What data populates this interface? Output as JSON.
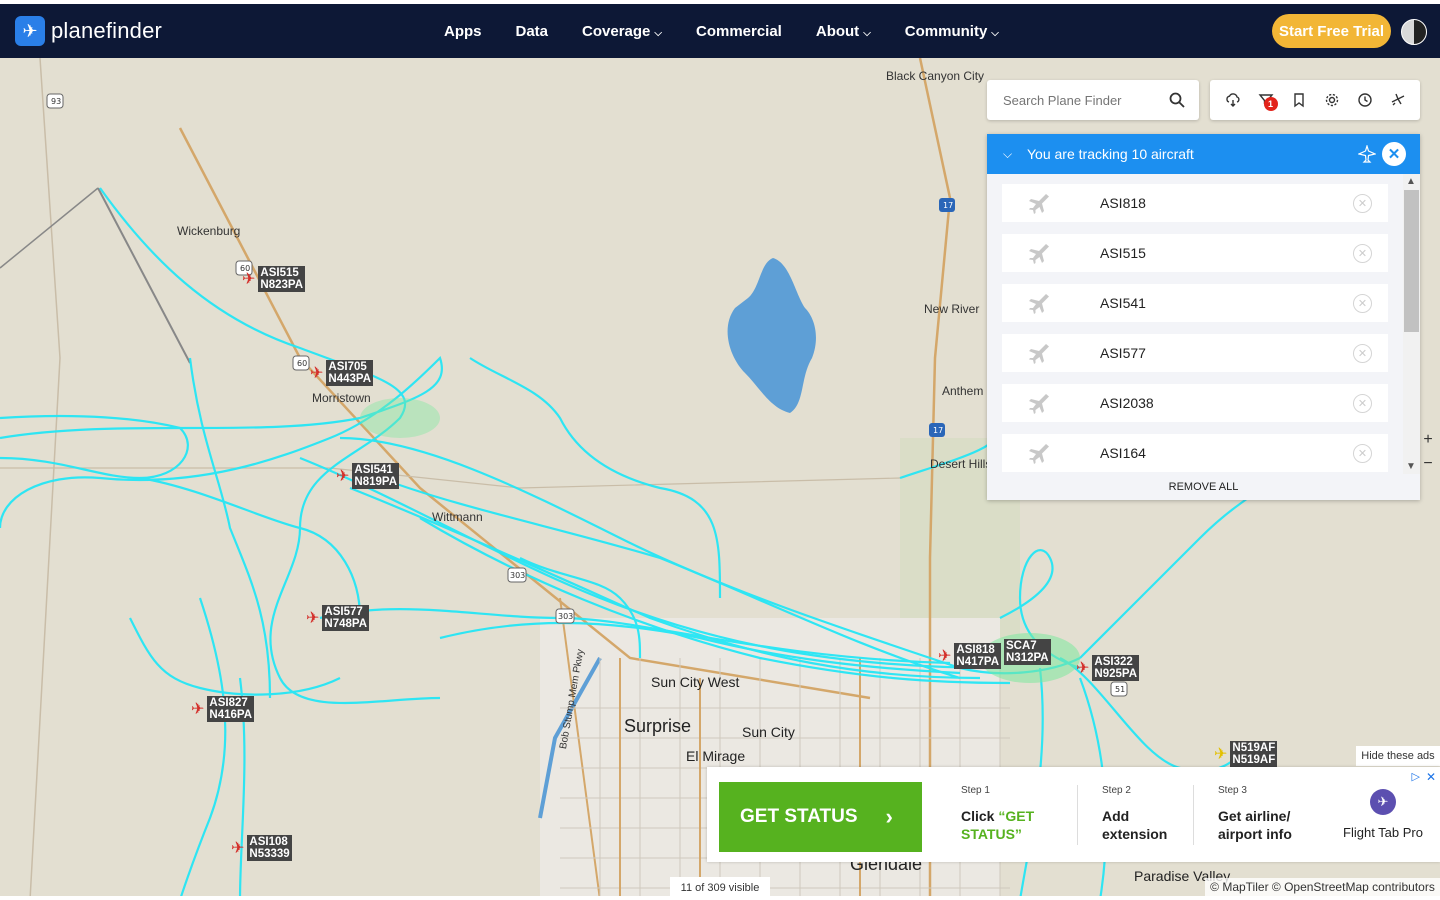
{
  "brand": {
    "name": "planefinder"
  },
  "nav": {
    "items": [
      {
        "label": "Apps",
        "has_dropdown": false
      },
      {
        "label": "Data",
        "has_dropdown": false
      },
      {
        "label": "Coverage",
        "has_dropdown": true
      },
      {
        "label": "Commercial",
        "has_dropdown": false
      },
      {
        "label": "About",
        "has_dropdown": true
      },
      {
        "label": "Community",
        "has_dropdown": true
      }
    ],
    "cta_label": "Start Free Trial"
  },
  "search": {
    "placeholder": "Search Plane Finder"
  },
  "toolbar": {
    "icons": [
      "cloud-download-icon",
      "filter-icon",
      "bookmark-icon",
      "settings-icon",
      "history-icon",
      "aircraft-settings-icon"
    ],
    "filter_badge": "1"
  },
  "tracking": {
    "title": "You are tracking 10 aircraft",
    "items": [
      "ASI818",
      "ASI515",
      "ASI541",
      "ASI577",
      "ASI2038",
      "ASI164"
    ],
    "remove_all_label": "REMOVE ALL"
  },
  "map": {
    "places": [
      {
        "name": "Black Canyon City",
        "size": "small"
      },
      {
        "name": "Wickenburg",
        "size": "small"
      },
      {
        "name": "Morristown",
        "size": "small"
      },
      {
        "name": "New River",
        "size": "small"
      },
      {
        "name": "Anthem",
        "size": "small"
      },
      {
        "name": "Desert Hills",
        "size": "small"
      },
      {
        "name": "Wittmann",
        "size": "small"
      },
      {
        "name": "Sun City West",
        "size": "mid"
      },
      {
        "name": "Surprise",
        "size": "big"
      },
      {
        "name": "Sun City",
        "size": "mid"
      },
      {
        "name": "El Mirage",
        "size": "mid"
      },
      {
        "name": "Glendale",
        "size": "big"
      },
      {
        "name": "Paradise Valley",
        "size": "mid"
      },
      {
        "name": "Bob Stump Mem Pkwy",
        "size": "small"
      }
    ],
    "road_shields": [
      "93",
      "60",
      "60",
      "17",
      "17",
      "51",
      "303",
      "303"
    ],
    "aircraft": [
      {
        "callsign": "ASI515",
        "reg": "N823PA",
        "color": "red"
      },
      {
        "callsign": "ASI705",
        "reg": "N443PA",
        "color": "red"
      },
      {
        "callsign": "ASI541",
        "reg": "N819PA",
        "color": "red"
      },
      {
        "callsign": "ASI577",
        "reg": "N748PA",
        "color": "red"
      },
      {
        "callsign": "ASI827",
        "reg": "N416PA",
        "color": "red"
      },
      {
        "callsign": "ASI108",
        "reg": "N53339",
        "color": "red"
      },
      {
        "callsign": "ASI818",
        "reg": "N417PA",
        "color": "red"
      },
      {
        "callsign": "SCA7",
        "reg": "N312PA",
        "color": "red"
      },
      {
        "callsign": "ASI322",
        "reg": "N925PA",
        "color": "red"
      },
      {
        "callsign": "N519AF",
        "reg": "N519AF",
        "color": "yellow"
      }
    ],
    "track_color": "#25e6f5",
    "visible_count": "11 of 309 visible",
    "attribution": "© MapTiler © OpenStreetMap contributors",
    "zoom_in": "+",
    "zoom_out": "−"
  },
  "ad": {
    "hide_label": "Hide these ads",
    "cta": "GET STATUS",
    "steps": [
      {
        "num": "Step 1",
        "text_a": "Click ",
        "text_b": "“GET STATUS”"
      },
      {
        "num": "Step 2",
        "text_a": "Add extension",
        "text_b": ""
      },
      {
        "num": "Step 3",
        "text_a": "Get airline/ airport info",
        "text_b": ""
      }
    ],
    "brand": "Flight Tab Pro",
    "close": "✕",
    "info": "▷"
  }
}
